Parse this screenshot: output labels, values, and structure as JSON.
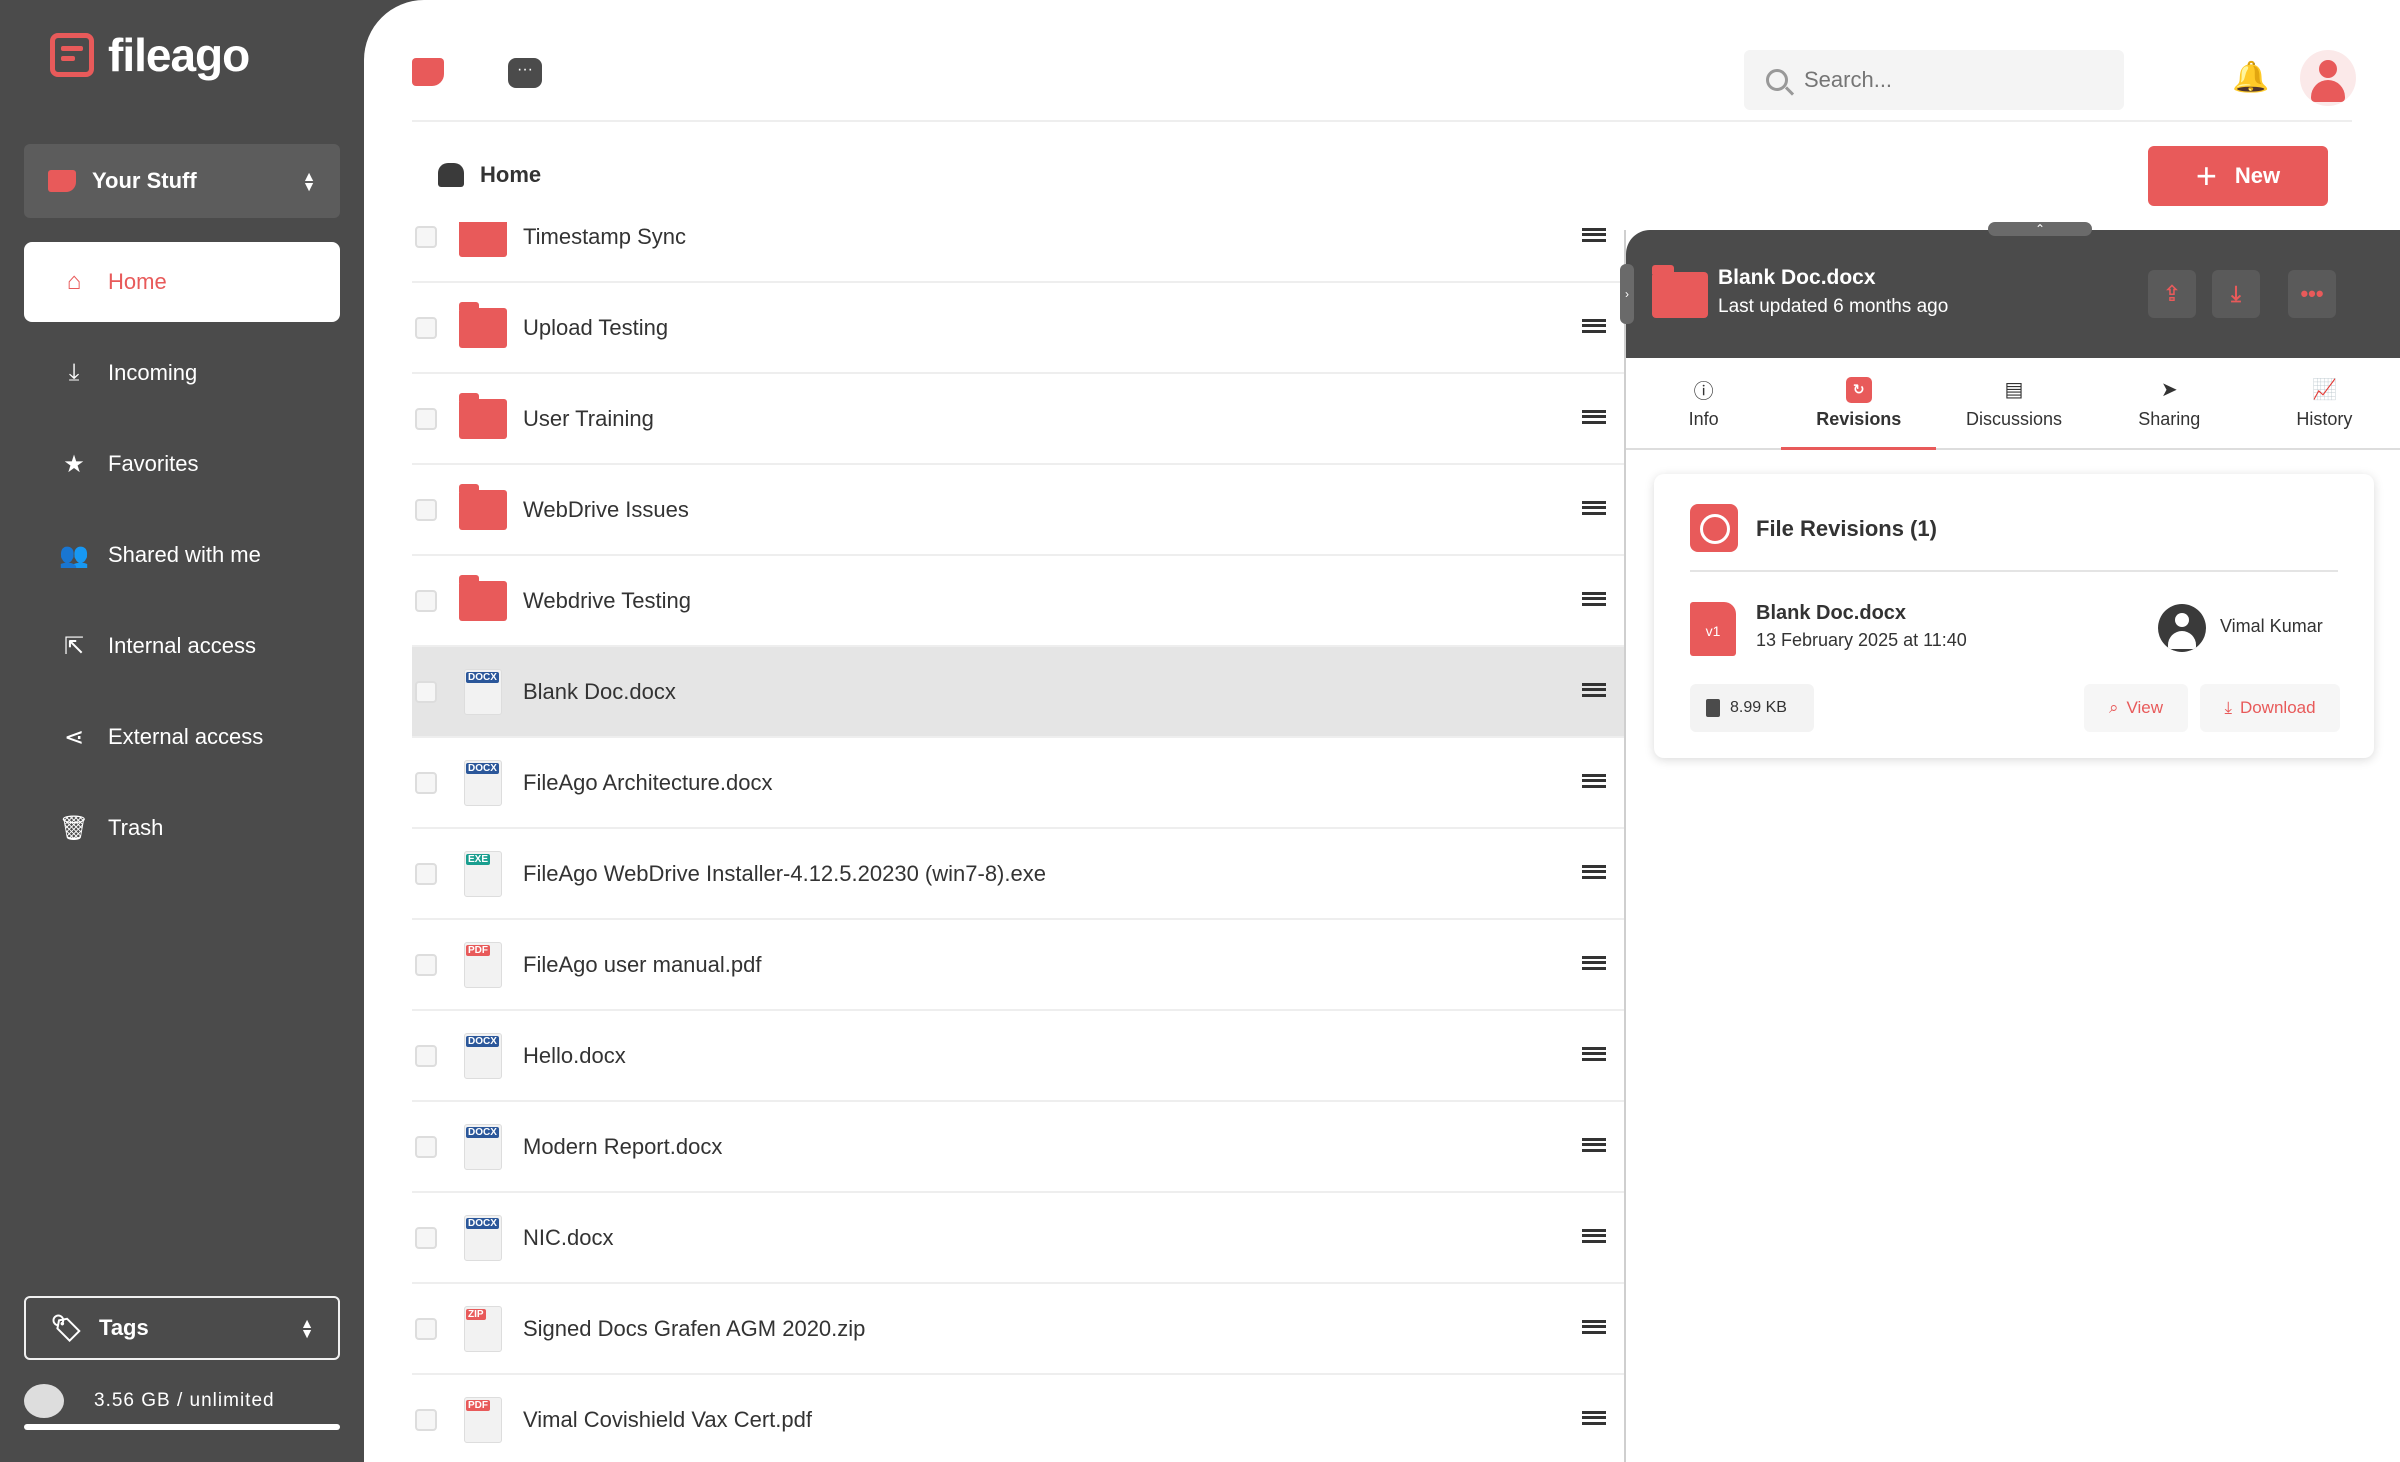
{
  "app": {
    "logo_text": "fileago"
  },
  "sidebar": {
    "workspace": "Your Stuff",
    "items": [
      {
        "label": "Home",
        "icon": "home-icon",
        "active": true
      },
      {
        "label": "Incoming",
        "icon": "download-icon"
      },
      {
        "label": "Favorites",
        "icon": "star-icon"
      },
      {
        "label": "Shared with me",
        "icon": "users-icon"
      },
      {
        "label": "Internal access",
        "icon": "share-box-icon"
      },
      {
        "label": "External access",
        "icon": "share-icon"
      },
      {
        "label": "Trash",
        "icon": "trash-icon"
      }
    ],
    "tags_label": "Tags",
    "storage": "3.56 GB / unlimited"
  },
  "header": {
    "search_placeholder": "Search...",
    "breadcrumb": "Home",
    "new_label": "New"
  },
  "files": [
    {
      "name": "Timestamp Sync",
      "type": "folder"
    },
    {
      "name": "Upload Testing",
      "type": "folder"
    },
    {
      "name": "User Training",
      "type": "folder"
    },
    {
      "name": "WebDrive Issues",
      "type": "folder"
    },
    {
      "name": "Webdrive Testing",
      "type": "folder"
    },
    {
      "name": "Blank Doc.docx",
      "type": "docx",
      "selected": true
    },
    {
      "name": "FileAgo Architecture.docx",
      "type": "docx"
    },
    {
      "name": "FileAgo WebDrive Installer-4.12.5.20230 (win7-8).exe",
      "type": "exe"
    },
    {
      "name": "FileAgo user manual.pdf",
      "type": "pdf"
    },
    {
      "name": "Hello.docx",
      "type": "docx"
    },
    {
      "name": "Modern Report.docx",
      "type": "docx"
    },
    {
      "name": "NIC.docx",
      "type": "docx"
    },
    {
      "name": "Signed Docs Grafen AGM 2020.zip",
      "type": "zip"
    },
    {
      "name": "Vimal Covishield Vax Cert.pdf",
      "type": "pdf"
    }
  ],
  "file_tags": {
    "docx": "DOCX",
    "exe": "EXE",
    "pdf": "PDF",
    "zip": "ZIP"
  },
  "details": {
    "title": "Blank Doc.docx",
    "subtitle": "Last updated 6 months ago",
    "tabs": [
      {
        "label": "Info",
        "icon": "info-icon"
      },
      {
        "label": "Revisions",
        "icon": "revisions-icon",
        "active": true
      },
      {
        "label": "Discussions",
        "icon": "discussion-icon"
      },
      {
        "label": "Sharing",
        "icon": "send-icon"
      },
      {
        "label": "History",
        "icon": "chart-icon"
      }
    ],
    "revisions": {
      "title": "File Revisions (1)",
      "version": "v1",
      "file_name": "Blank Doc.docx",
      "date": "13 February 2025 at 11:40",
      "user": "Vimal Kumar",
      "size": "8.99 KB",
      "view_label": "View",
      "download_label": "Download"
    }
  },
  "colors": {
    "accent": "#e85a5a",
    "sidebar": "#4b4b4b"
  }
}
